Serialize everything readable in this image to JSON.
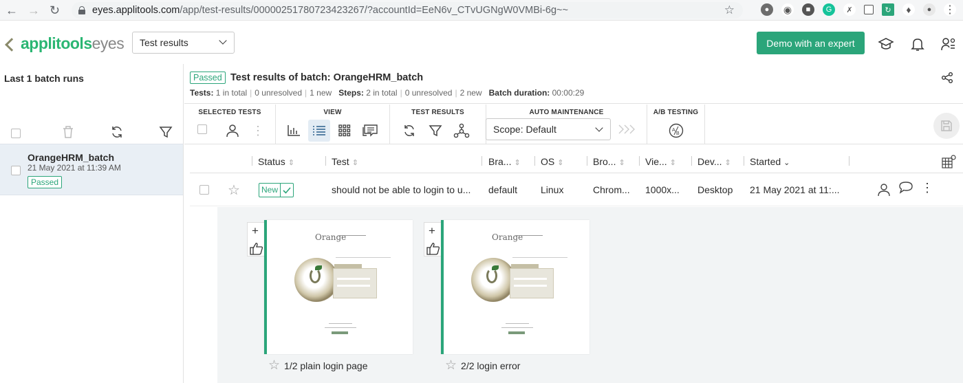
{
  "browser": {
    "url_host": "eyes.applitools.com",
    "url_path": "/app/test-results/00000251780723423267/?accountId=EeN6v_CTvUGNgW0VMBi-6g~~"
  },
  "header": {
    "logo_brand": "applitools",
    "logo_product": "eyes",
    "page_select": "Test results",
    "demo_button": "Demo with an expert"
  },
  "sidebar": {
    "title": "Last 1 batch runs",
    "batch": {
      "name": "OrangeHRM_batch",
      "date": "21 May 2021 at 11:39 AM",
      "status": "Passed"
    }
  },
  "batch": {
    "status": "Passed",
    "title": "Test results of batch: OrangeHRM_batch",
    "tests_label": "Tests:",
    "tests_total": "1 in total",
    "tests_unresolved": "0 unresolved",
    "tests_new": "1 new",
    "steps_label": "Steps:",
    "steps_total": "2 in total",
    "steps_unresolved": "0 unresolved",
    "steps_new": "2 new",
    "duration_label": "Batch duration:",
    "duration": "00:00:29"
  },
  "toolbar": {
    "selected_tests": "SELECTED TESTS",
    "view": "VIEW",
    "test_results": "TEST RESULTS",
    "auto_maintenance": "AUTO MAINTENANCE",
    "ab_testing": "A/B TESTING",
    "scope": "Scope: Default"
  },
  "table": {
    "columns": [
      "Status",
      "Test",
      "Bra...",
      "OS",
      "Bro...",
      "Vie...",
      "Dev...",
      "Started"
    ],
    "row": {
      "status": "New",
      "test": "should not be able to login to u...",
      "branch": "default",
      "os": "Linux",
      "browser": "Chrom...",
      "viewport": "1000x...",
      "device": "Desktop",
      "started": "21 May 2021 at 11:..."
    }
  },
  "steps": [
    {
      "name": "1/2 plain login page",
      "logo_text": "Orange"
    },
    {
      "name": "2/2 login error",
      "logo_text": "Orange"
    }
  ]
}
